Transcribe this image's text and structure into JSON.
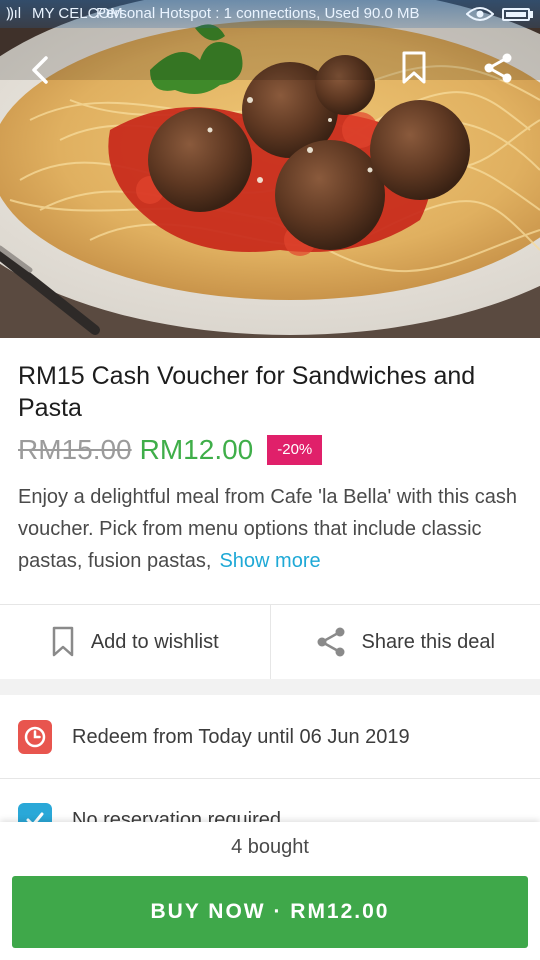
{
  "status_bar": {
    "signal": "⸩ıl",
    "carrier": "MY CELCOM",
    "hotspot": "Personal Hotspot : 1 connections, Used 90.0 MB",
    "icons": [
      "signal-icon",
      "eye-icon",
      "battery-icon"
    ]
  },
  "hero": {
    "image": "spaghetti-meatballs-photo",
    "icons": [
      "back-arrow-icon",
      "bookmark-icon",
      "share-icon"
    ]
  },
  "deal": {
    "title": "RM15 Cash Voucher for Sandwiches and Pasta",
    "original_price": "RM15.00",
    "price": "RM12.00",
    "discount": "-20%",
    "description": "Enjoy a delightful meal from Cafe 'la Bella' with this cash voucher. Pick from menu options that include classic pastas, fusion pastas,",
    "show_more": "Show more"
  },
  "actions": {
    "wishlist": "Add to wishlist",
    "share": "Share this deal"
  },
  "info": {
    "redeem": "Redeem from Today until 06 Jun 2019",
    "reservation": "No reservation required"
  },
  "footer": {
    "bought": "4 bought",
    "buy_label": "BUY NOW · RM12.00"
  },
  "colors": {
    "accent_green": "#3fa84a",
    "discount_pink": "#e0206a",
    "link_blue": "#1fa9d6",
    "clock_red": "#e8554e",
    "check_blue": "#2aa8d8"
  }
}
